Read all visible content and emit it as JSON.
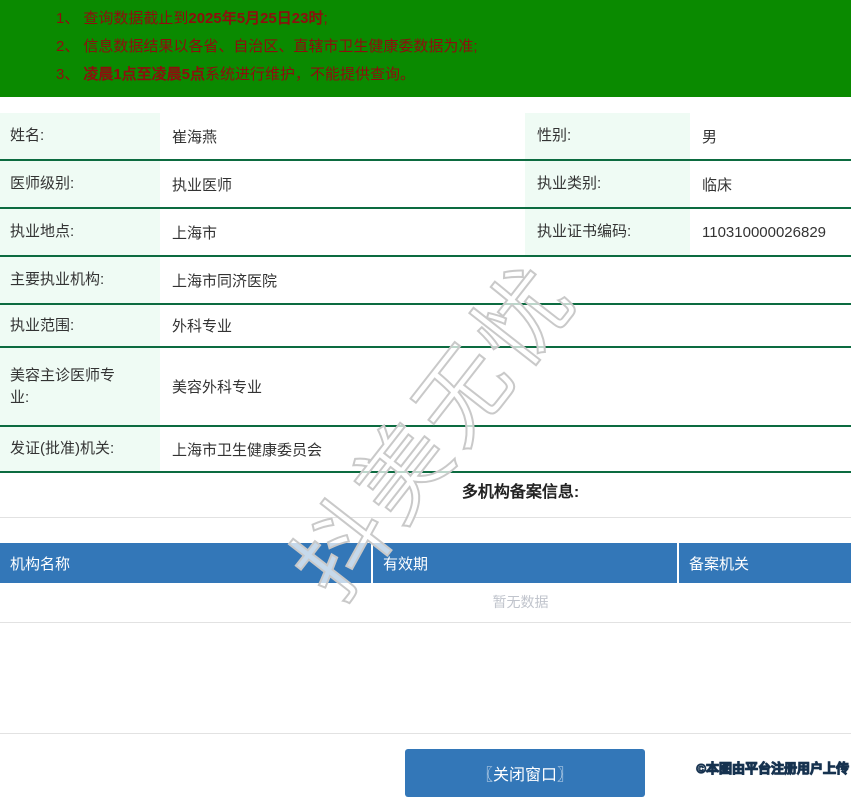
{
  "banner": {
    "notices": [
      {
        "num": "1、",
        "pre": "查询数据截止到",
        "bold": "2025年5月25日23时",
        "post": ";"
      },
      {
        "num": "2、",
        "pre": "信息数据结果以各省、自治区、直辖市卫生健康委数据为准;",
        "bold": "",
        "post": ""
      },
      {
        "num": "3、",
        "pre": "",
        "bold": "凌晨1点至凌晨5点",
        "post": "系统进行维护，不能提供查询。"
      }
    ]
  },
  "info": {
    "rows": [
      {
        "cells": [
          {
            "label": "姓名:",
            "value": "崔海燕"
          },
          {
            "label": "性别:",
            "value": "男"
          }
        ]
      },
      {
        "cells": [
          {
            "label": "医师级别:",
            "value": "执业医师"
          },
          {
            "label": "执业类别:",
            "value": "临床"
          }
        ]
      },
      {
        "cells": [
          {
            "label": "执业地点:",
            "value": "上海市"
          },
          {
            "label": "执业证书编码:",
            "value": "110310000026829"
          }
        ]
      },
      {
        "cells": [
          {
            "label": "主要执业机构:",
            "value": "上海市同济医院"
          }
        ]
      },
      {
        "cells": [
          {
            "label": "执业范围:",
            "value": "外科专业"
          }
        ]
      },
      {
        "cells": [
          {
            "label": "美容主诊医师专业:",
            "value": "美容外科专业"
          }
        ]
      },
      {
        "cells": [
          {
            "label": "发证(批准)机关:",
            "value": "上海市卫生健康委员会"
          }
        ]
      }
    ]
  },
  "multi_org": {
    "heading": "多机构备案信息:",
    "columns": [
      "机构名称",
      "有效期",
      "备案机关"
    ],
    "empty_text": "暂无数据"
  },
  "footer": {
    "close_button": "〖关闭窗口〗"
  },
  "watermark": {
    "center": "抖美无忧",
    "corner": "©本图由平台注册用户上传"
  },
  "colors": {
    "banner_bg": "#0A8A00",
    "notice_red": "#8E0E0E",
    "border_green": "#0C6B40",
    "label_bg": "#EFFBF4",
    "text_dark": "#333333",
    "blue": "#3377B8",
    "empty_gray": "#C0C4CC",
    "divider": "#E2E2E2",
    "watermark_stroke": "#C9C9C9"
  }
}
